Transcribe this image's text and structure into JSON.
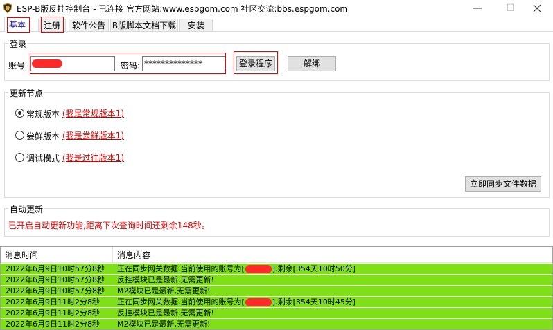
{
  "window": {
    "title": "ESP-B版反挂控制台 - 已连接    官方网站:www.espgom.com 社区交流:bbs.espgom.com",
    "minimize": "—",
    "maximize": "☐"
  },
  "tabs": [
    {
      "label": "基本",
      "active": true
    },
    {
      "label": "注册",
      "active": false
    },
    {
      "label": "软件公告",
      "active": false
    },
    {
      "label": "B版脚本文档下载",
      "active": false
    },
    {
      "label": "安装",
      "active": false
    }
  ],
  "login": {
    "group_title": "登录",
    "account_label": "账号",
    "account_value": "",
    "password_label": "密码:",
    "password_value": "**************",
    "login_button": "登录程序",
    "unbind_button": "解绑"
  },
  "nodes": {
    "group_title": "更新节点",
    "options": [
      {
        "label": "常规版本",
        "link": "(我是常规版本1)",
        "selected": true
      },
      {
        "label": "尝鲜版本",
        "link": "(我是尝鲜版本1)",
        "selected": false
      },
      {
        "label": "调试模式",
        "link": "(我是过往版本1)",
        "selected": false
      }
    ],
    "sync_button": "立即同步文件数据"
  },
  "auto_update": {
    "group_title": "自动更新",
    "message": "已开启自动更新功能,距离下次查询时间还剩余148秒。"
  },
  "log": {
    "columns": [
      "消息时间",
      "消息内容"
    ],
    "rows": [
      {
        "time": "2022年6月9日10时57分8秒",
        "msg_before": "正在同步网关数据,当前使用的账号为[",
        "redacted": true,
        "msg_after": "],剩余[354天10时50分]"
      },
      {
        "time": "2022年6月9日10时57分8秒",
        "msg_before": "反挂模块已是最新,无需更新!",
        "redacted": false,
        "msg_after": ""
      },
      {
        "time": "2022年6月9日10时57分8秒",
        "msg_before": "M2模块已是最新,无需更新!",
        "redacted": false,
        "msg_after": ""
      },
      {
        "time": "2022年6月9日11时2分8秒",
        "msg_before": "正在同步网关数据,当前使用的账号为[",
        "redacted": true,
        "msg_after": "],剩余[354天10时45分]"
      },
      {
        "time": "2022年6月9日11时2分8秒",
        "msg_before": "反挂模块已是最新,无需更新!",
        "redacted": false,
        "msg_after": ""
      },
      {
        "time": "2022年6月9日11时2分8秒",
        "msg_before": "M2模块已是最新,无需更新!",
        "redacted": false,
        "msg_after": ""
      }
    ]
  },
  "colors": {
    "row_green": "#7fe01a",
    "highlight_red": "#e00000",
    "link_red": "#d00000"
  },
  "icons": {
    "app": "shield-icon",
    "close": "close-icon"
  }
}
